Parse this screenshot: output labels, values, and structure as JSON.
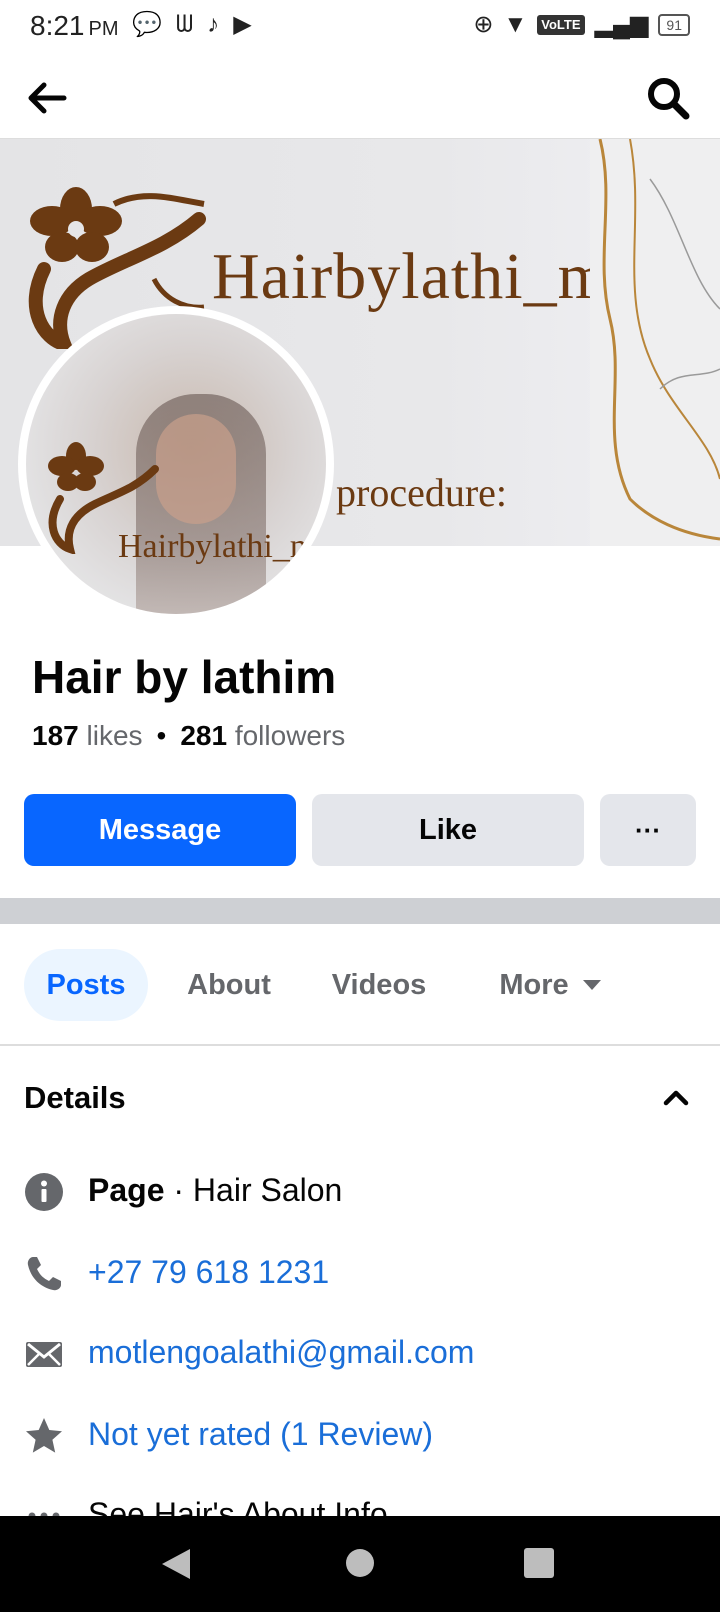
{
  "status_bar": {
    "time": "8:21",
    "ampm": "PM",
    "network_badge": "VoLTE",
    "battery": "91"
  },
  "topbar": {
    "back_icon": "arrow-left-icon",
    "search_icon": "search-icon"
  },
  "cover": {
    "brand_text": "Hairbylathi_m",
    "sub_text": "procedure:",
    "brand_color": "#6b3a12"
  },
  "avatar": {
    "brand_text": "Hairbylathi_m"
  },
  "profile": {
    "name": "Hair by lathim",
    "likes_count": "187",
    "likes_label": "likes",
    "followers_count": "281",
    "followers_label": "followers"
  },
  "actions": {
    "message_label": "Message",
    "like_label": "Like",
    "more_label": "···",
    "accent": "#0866ff"
  },
  "tabs": [
    {
      "label": "Posts",
      "active": true
    },
    {
      "label": "About",
      "active": false
    },
    {
      "label": "Videos",
      "active": false
    },
    {
      "label": "More",
      "active": false
    }
  ],
  "details": {
    "title": "Details",
    "page_label": "Page",
    "category": "· Hair Salon",
    "phone": "+27 79 618 1231",
    "email": "motlengoalathi@gmail.com",
    "rating": "Not yet rated (1 Review)",
    "see_more": "See Hair's About Info"
  }
}
